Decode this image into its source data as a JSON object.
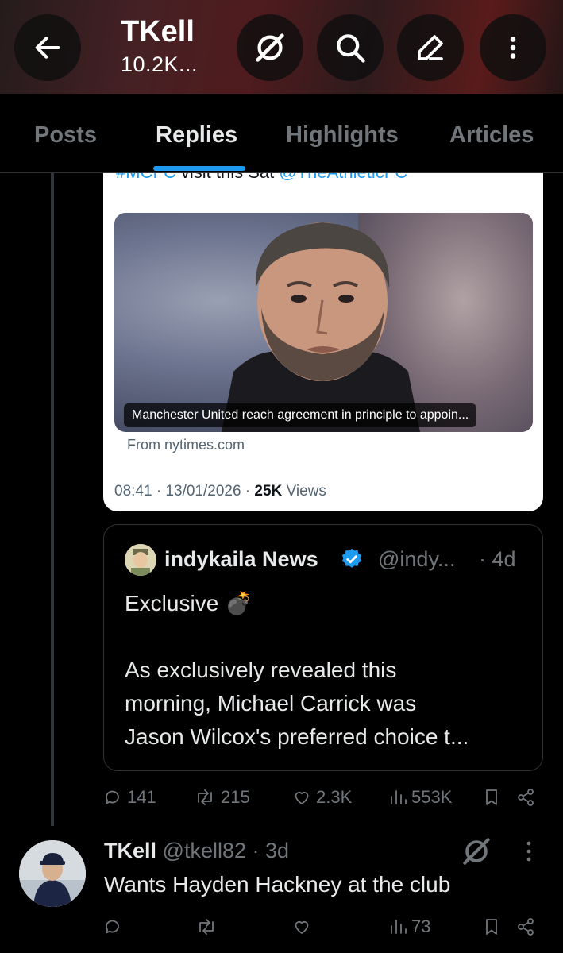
{
  "header": {
    "name": "TKell",
    "subtitle": "10.2K...",
    "icons": [
      "arrow-left-icon",
      "grok-icon",
      "search-icon",
      "edit-icon",
      "more-vertical-icon"
    ]
  },
  "tabs": [
    {
      "label": "Posts",
      "active": false
    },
    {
      "label": "Replies",
      "active": true
    },
    {
      "label": "Highlights",
      "active": false
    },
    {
      "label": "Articles",
      "active": false
    }
  ],
  "card": {
    "top_text_hashtag": "#MCFC",
    "top_text_plain": " visit this Sat ",
    "top_text_mention": "@TheAthleticFC",
    "caption": "Manchester United reach agreement in principle to appoin...",
    "source": "From nytimes.com",
    "time": "08:41 · 13/01/2026 · ",
    "views_count": "25K",
    "views_label": " Views"
  },
  "quote": {
    "name": "indykaila News",
    "handle": "@indy...",
    "time": "· 4d",
    "lines": [
      "Exclusive 💣",
      "",
      "As exclusively revealed this",
      "morning, Michael Carrick was",
      "Jason Wilcox's preferred choice t..."
    ]
  },
  "actions_main": {
    "replies": "141",
    "reposts": "215",
    "likes": "2.3K",
    "views": "553K"
  },
  "reply": {
    "name": "TKell",
    "handle": "@tkell82",
    "time": "· 3d",
    "text": "Wants Hayden Hackney at the club",
    "views": "73"
  },
  "colors": {
    "accent": "#1d9bf0",
    "muted": "#71767b",
    "text": "#e7e9ea",
    "background": "#000000"
  }
}
